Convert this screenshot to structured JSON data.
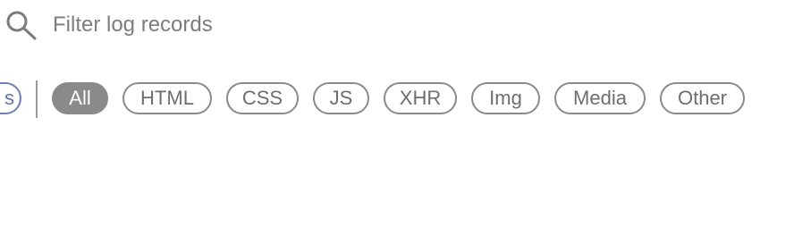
{
  "search": {
    "placeholder": "Filter log records",
    "value": ""
  },
  "filters": {
    "partial_label": "s",
    "chips": [
      {
        "label": "All",
        "active": true
      },
      {
        "label": "HTML",
        "active": false
      },
      {
        "label": "CSS",
        "active": false
      },
      {
        "label": "JS",
        "active": false
      },
      {
        "label": "XHR",
        "active": false
      },
      {
        "label": "Img",
        "active": false
      },
      {
        "label": "Media",
        "active": false
      },
      {
        "label": "Other",
        "active": false
      }
    ]
  },
  "colors": {
    "chip_border": "#8a8a8a",
    "chip_text": "#6e6e6e",
    "active_chip_bg": "#8a8a8a",
    "active_chip_text": "#ffffff",
    "partial_chip_border": "#6f7fb8",
    "placeholder_text": "#7d7d7d"
  },
  "icons": {
    "search": "search-icon"
  }
}
